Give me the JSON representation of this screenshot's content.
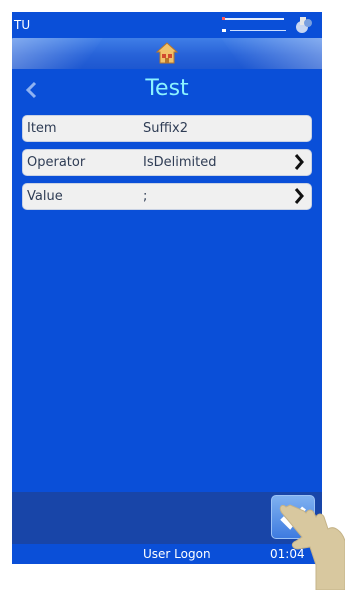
{
  "status_bar": {
    "left_text": "TU",
    "wifi_icon": "wifi-icon",
    "system_icon": "settings-icon"
  },
  "home": {
    "icon": "home-icon"
  },
  "header": {
    "title": "Test",
    "back_icon": "chevron-left-icon"
  },
  "rows": [
    {
      "label": "Item",
      "value": "Suffix2",
      "has_chevron": false
    },
    {
      "label": "Operator",
      "value": "IsDelimited",
      "has_chevron": true
    },
    {
      "label": "Value",
      "value": ";",
      "has_chevron": true
    }
  ],
  "footer": {
    "user_logon": "User Logon",
    "time": "01:04"
  },
  "colors": {
    "screen_bg": "#0a4fd8",
    "title": "#8cf3ff",
    "row_bg": "#f0f0f0",
    "bottom_panel": "#1845a8"
  }
}
